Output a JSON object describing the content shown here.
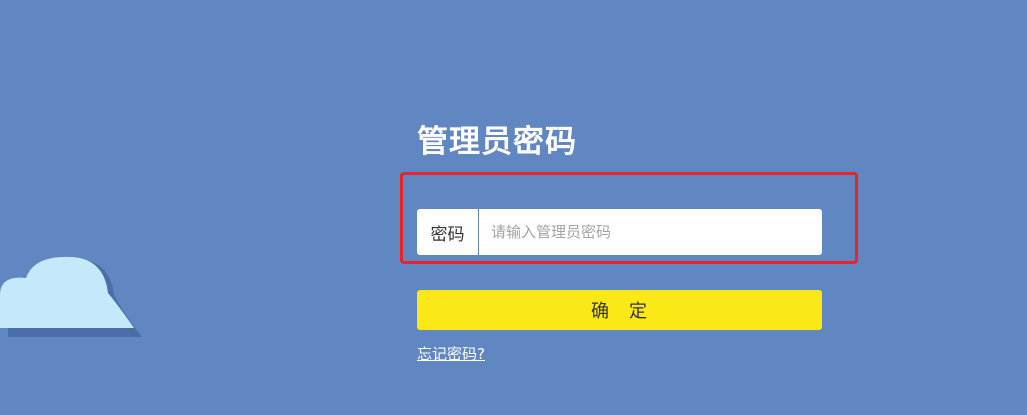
{
  "login": {
    "title": "管理员密码",
    "password_label": "密码",
    "password_placeholder": "请输入管理员密码",
    "password_value": "",
    "confirm_label": "确　定",
    "forgot_link": "忘记密码?"
  },
  "colors": {
    "background": "#6187c2",
    "confirm_button": "#fae817",
    "highlight_border": "#e8242a",
    "cloud_fill": "#c5e8fb",
    "cloud_shadow": "#4a6fa8"
  },
  "icons": {
    "decoration": "cloud-icon"
  }
}
